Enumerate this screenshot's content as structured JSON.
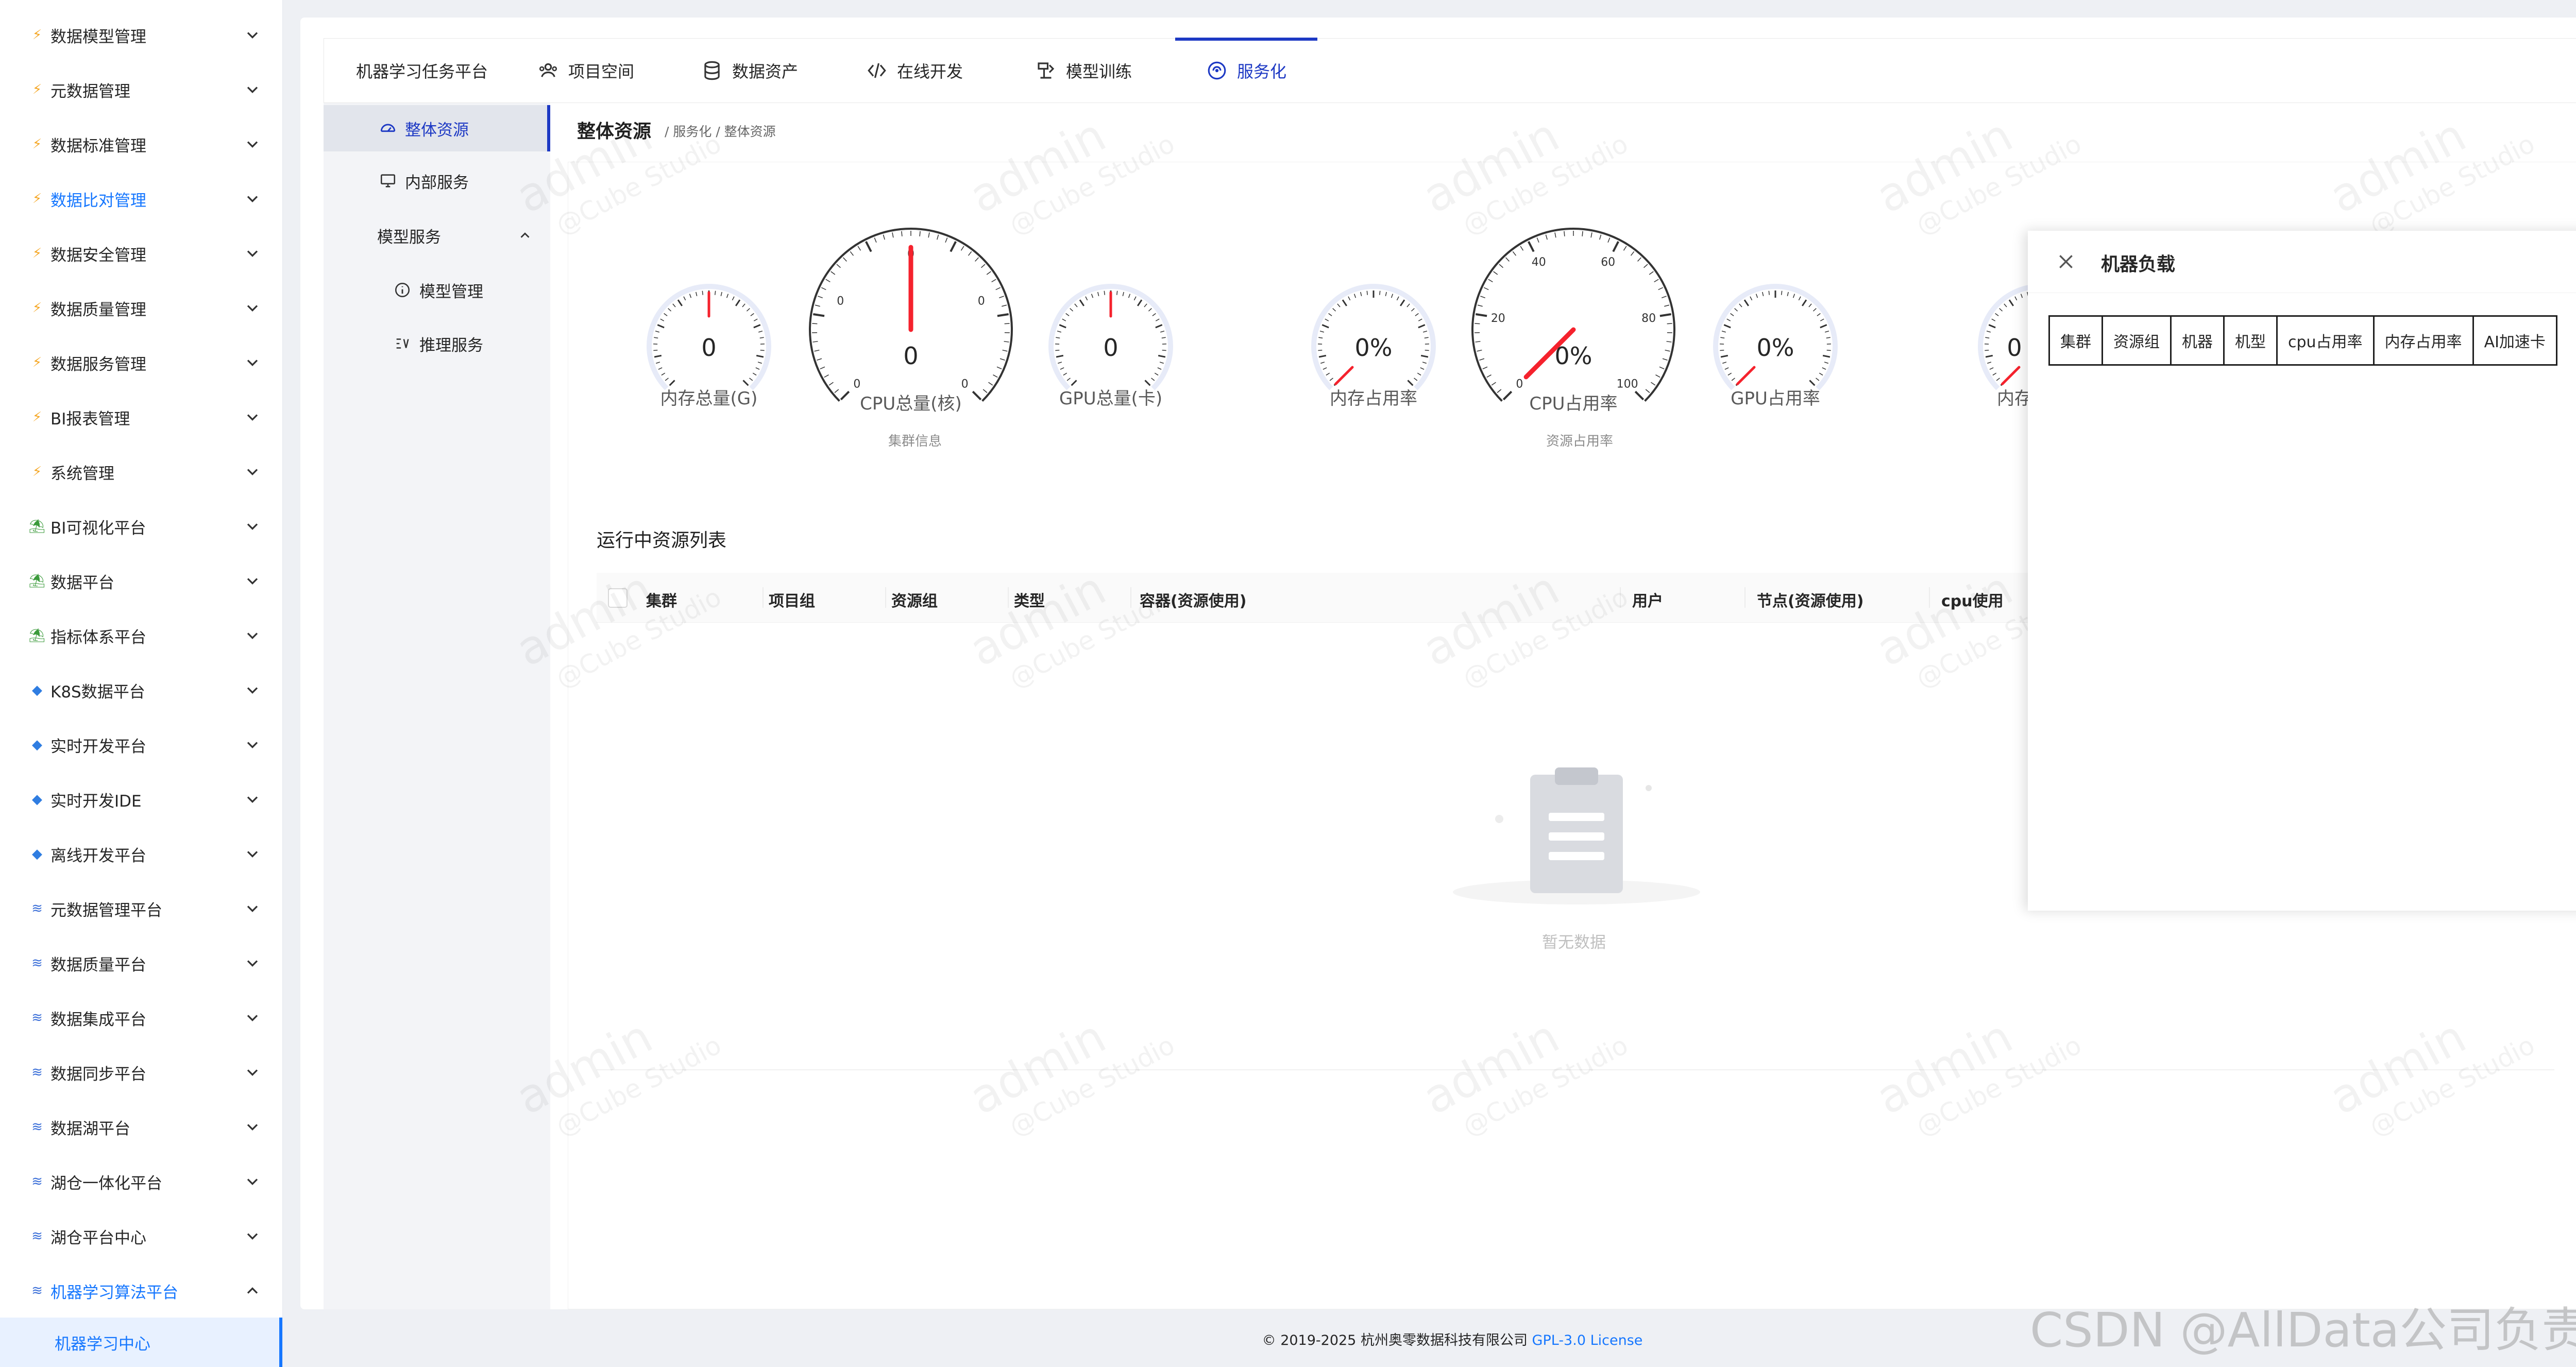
{
  "sidebar": {
    "items": [
      {
        "label": "数据模型管理",
        "glyph": "⚡",
        "glyph_color": "#f5a623"
      },
      {
        "label": "元数据管理",
        "glyph": "⚡",
        "glyph_color": "#f5a623"
      },
      {
        "label": "数据标准管理",
        "glyph": "⚡",
        "glyph_color": "#f5a623"
      },
      {
        "label": "数据比对管理",
        "glyph": "⚡",
        "glyph_color": "#f5a623"
      },
      {
        "label": "数据安全管理",
        "glyph": "⚡",
        "glyph_color": "#f5a623"
      },
      {
        "label": "数据质量管理",
        "glyph": "⚡",
        "glyph_color": "#f5a623"
      },
      {
        "label": "数据服务管理",
        "glyph": "⚡",
        "glyph_color": "#f5a623"
      },
      {
        "label": "BI报表管理",
        "glyph": "⚡",
        "glyph_color": "#f5a623"
      },
      {
        "label": "系统管理",
        "glyph": "⚡",
        "glyph_color": "#f5a623"
      },
      {
        "label": "BI可视化平台",
        "glyph": "⛱",
        "glyph_color": "#3a9a3a"
      },
      {
        "label": "数据平台",
        "glyph": "⛱",
        "glyph_color": "#3a9a3a"
      },
      {
        "label": "指标体系平台",
        "glyph": "⛱",
        "glyph_color": "#3a9a3a"
      },
      {
        "label": "K8S数据平台",
        "glyph": "◆",
        "glyph_color": "#2f7de1"
      },
      {
        "label": "实时开发平台",
        "glyph": "◆",
        "glyph_color": "#2f7de1"
      },
      {
        "label": "实时开发IDE",
        "glyph": "◆",
        "glyph_color": "#2f7de1"
      },
      {
        "label": "离线开发平台",
        "glyph": "◆",
        "glyph_color": "#2f7de1"
      },
      {
        "label": "元数据管理平台",
        "glyph": "≋",
        "glyph_color": "#3b6fd8"
      },
      {
        "label": "数据质量平台",
        "glyph": "≋",
        "glyph_color": "#3b6fd8"
      },
      {
        "label": "数据集成平台",
        "glyph": "≋",
        "glyph_color": "#3b6fd8"
      },
      {
        "label": "数据同步平台",
        "glyph": "≋",
        "glyph_color": "#3b6fd8"
      },
      {
        "label": "数据湖平台",
        "glyph": "≋",
        "glyph_color": "#3b6fd8"
      },
      {
        "label": "湖仓一体化平台",
        "glyph": "≋",
        "glyph_color": "#3b6fd8"
      },
      {
        "label": "湖仓平台中心",
        "glyph": "≋",
        "glyph_color": "#3b6fd8"
      },
      {
        "label": "机器学习算法平台",
        "glyph": "≋",
        "glyph_color": "#3b6fd8"
      }
    ],
    "sub_item": "机器学习中心"
  },
  "topnav": {
    "tabs": [
      {
        "label": "机器学习任务平台",
        "icon": ""
      },
      {
        "label": "项目空间",
        "icon": "team-icon"
      },
      {
        "label": "数据资产",
        "icon": "database-icon"
      },
      {
        "label": "在线开发",
        "icon": "code-icon"
      },
      {
        "label": "模型训练",
        "icon": "training-icon"
      },
      {
        "label": "服务化",
        "icon": "service-icon"
      }
    ],
    "active": "服务化"
  },
  "submenu": {
    "items": [
      "整体资源",
      "内部服务",
      "模型服务",
      "模型管理",
      "推理服务"
    ],
    "active": "整体资源"
  },
  "page": {
    "title": "整体资源",
    "breadcrumb": "/ 服务化 / 整体资源"
  },
  "gauges": {
    "cluster": {
      "group_label": "集群信息",
      "items": [
        {
          "label": "内存总量(G)",
          "value": "0"
        },
        {
          "label": "CPU总量(核)",
          "value": "0"
        },
        {
          "label": "GPU总量(卡)",
          "value": "0"
        }
      ],
      "big_ticks": [
        "0",
        "0",
        "0",
        "0",
        "0"
      ]
    },
    "usage": {
      "group_label": "资源占用率",
      "items": [
        {
          "label": "内存占用率",
          "value": "0%"
        },
        {
          "label": "CPU占用率",
          "value": "0%"
        },
        {
          "label": "GPU占用率",
          "value": "0%"
        }
      ],
      "big_ticks": [
        "0",
        "20",
        "40",
        "60",
        "80",
        "100"
      ]
    },
    "partial": {
      "label": "内存",
      "value": "0"
    }
  },
  "resource_list": {
    "title": "运行中资源列表",
    "columns": [
      "集群",
      "项目组",
      "资源组",
      "类型",
      "容器(资源使用)",
      "用户",
      "节点(资源使用)",
      "cpu使用"
    ],
    "rows": [],
    "empty_text": "暂无数据"
  },
  "drawer": {
    "title": "机器负载",
    "columns": [
      "集群",
      "资源组",
      "机器",
      "机型",
      "cpu占用率",
      "内存占用率",
      "AI加速卡"
    ]
  },
  "watermark": {
    "line1": "admin",
    "line2": "@Cube Studio"
  },
  "footer": {
    "text": "© 2019-2025 杭州奥零数据科技有限公司",
    "link": "GPL-3.0 License"
  },
  "csdn_watermark": "CSDN @AllData公司负责人",
  "colors": {
    "accent": "#1d39c4",
    "link": "#1677ff",
    "needle": "#f5222d"
  }
}
